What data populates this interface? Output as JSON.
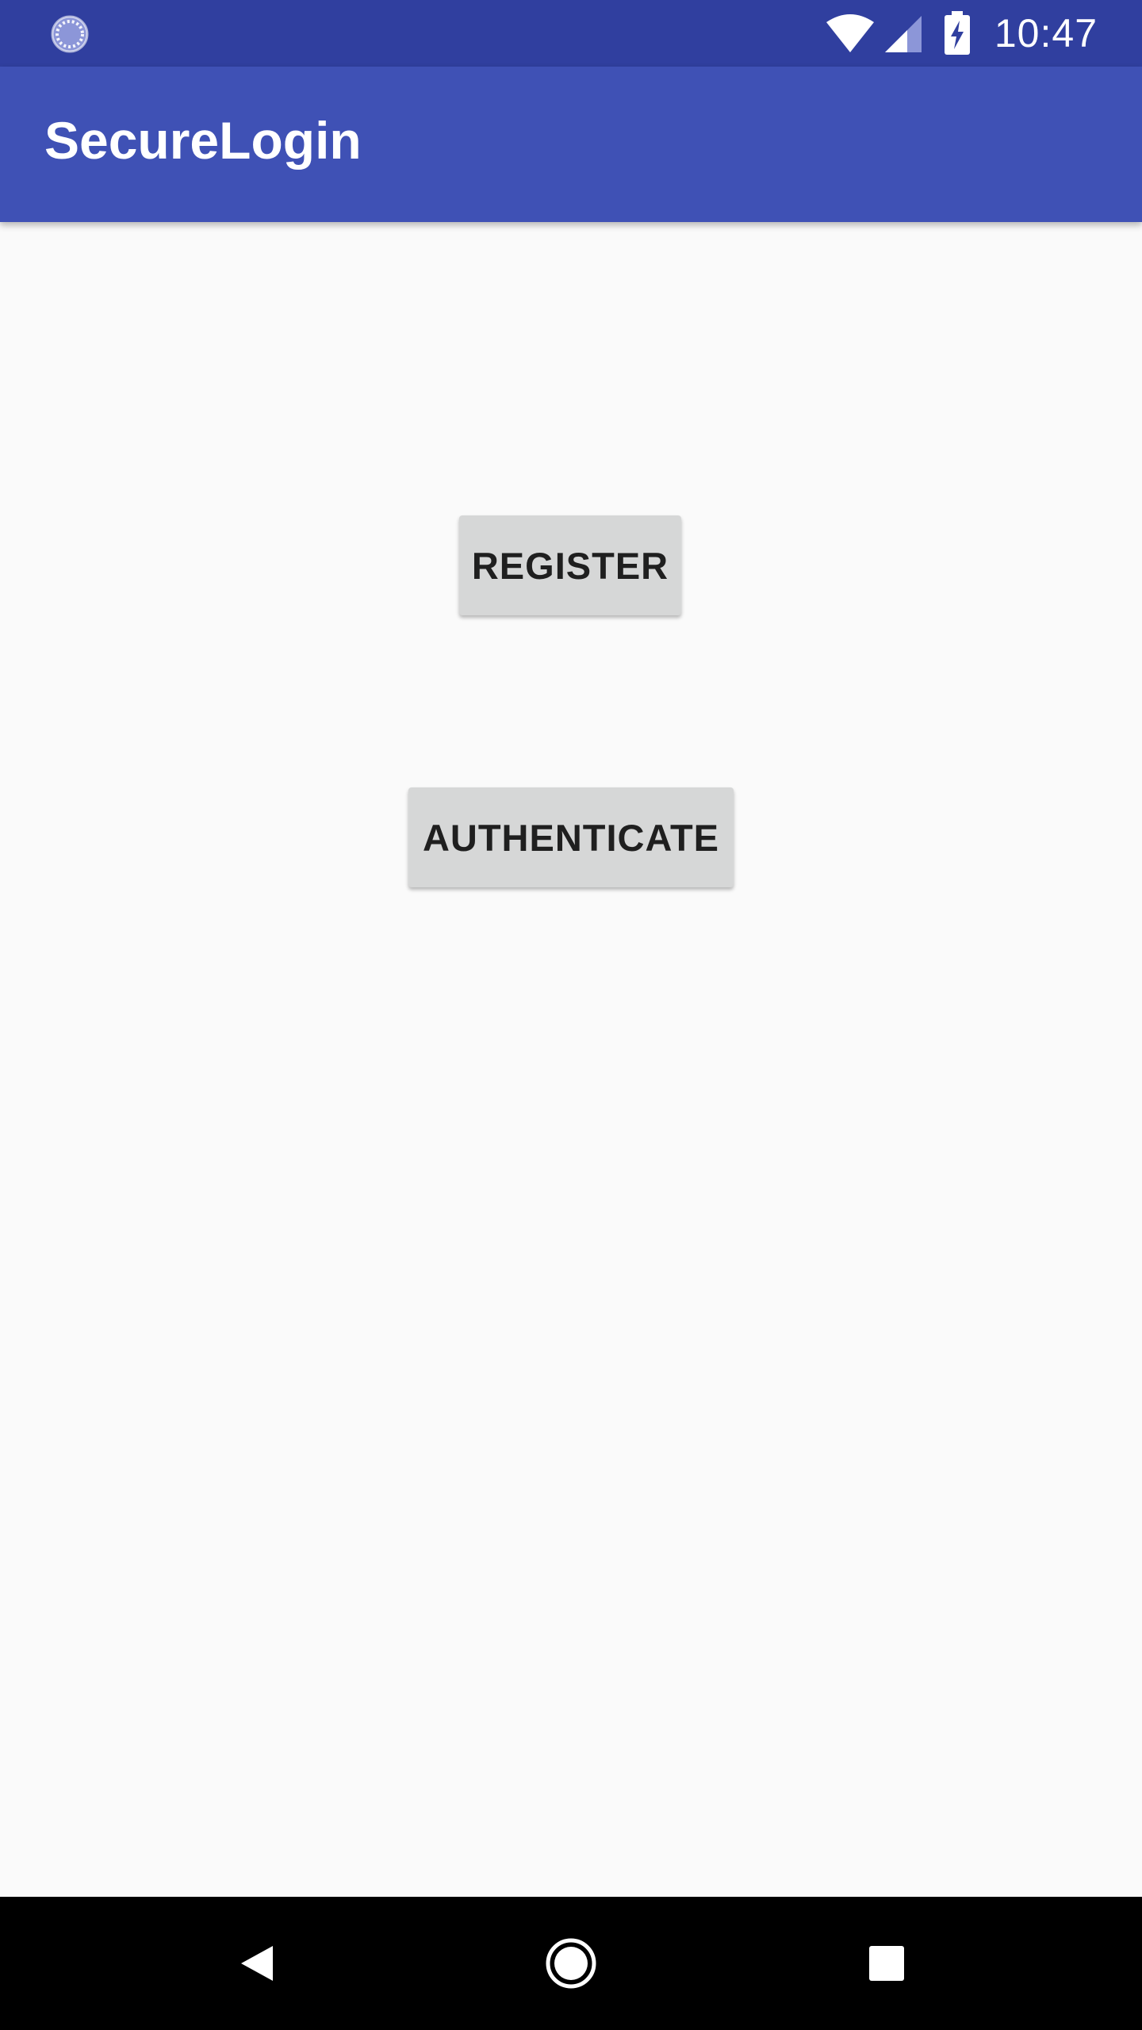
{
  "status_bar": {
    "time": "10:47",
    "left_icon": "sync-loading-icon",
    "icons": [
      "wifi-icon",
      "signal-icon",
      "battery-charging-icon"
    ],
    "background": "#303f9f"
  },
  "app_bar": {
    "title": "SecureLogin",
    "background": "#3f51b5"
  },
  "main": {
    "buttons": [
      {
        "label": "REGISTER"
      },
      {
        "label": "AUTHENTICATE"
      }
    ]
  },
  "nav_bar": {
    "icons": [
      "back-icon",
      "home-icon",
      "recents-icon"
    ]
  }
}
